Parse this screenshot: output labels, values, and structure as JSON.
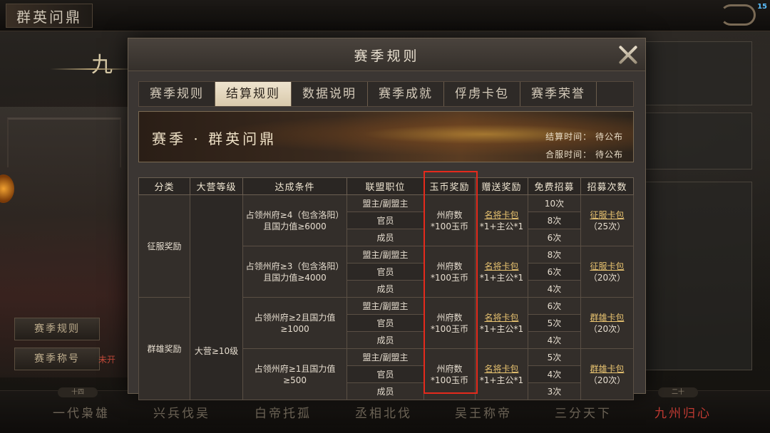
{
  "background": {
    "top_title": "群英问鼎",
    "version_badge": "15",
    "chapter_title_char": "九",
    "left_buttons": [
      "赛季规则",
      "赛季称号"
    ],
    "left_red_text": "未开",
    "chapters": [
      {
        "label": "一代枭雄",
        "num": "十四"
      },
      {
        "label": "兴兵伐吴",
        "num": ""
      },
      {
        "label": "白帝托孤",
        "num": ""
      },
      {
        "label": "丞相北伐",
        "num": ""
      },
      {
        "label": "吴王称帝",
        "num": ""
      },
      {
        "label": "三分天下",
        "num": ""
      },
      {
        "label": "九州归心",
        "num": "二十"
      }
    ]
  },
  "modal": {
    "title": "赛季规则",
    "tabs": [
      "赛季规则",
      "结算规则",
      "数据说明",
      "赛季成就",
      "俘虏卡包",
      "赛季荣誉"
    ],
    "active_tab": 1,
    "banner": {
      "title": "赛季 · 群英问鼎",
      "settle_time": "结算时间：  待公布",
      "merge_time": "合服时间：  待公布"
    },
    "table": {
      "headers": [
        "分类",
        "大营等级",
        "达成条件",
        "联盟职位",
        "玉币奖励",
        "赠送奖励",
        "免费招募",
        "招募次数"
      ],
      "category_conquer": "征服奖励",
      "category_heroes": "群雄奖励",
      "camp_level": "大营≥10级",
      "position_leader": "盟主/副盟主",
      "position_officer": "官员",
      "position_member": "成员",
      "jade_reward_line1": "州府数",
      "jade_reward_line2": "*100玉币",
      "gift_line1": "名将卡包",
      "gift_line2": "*1+主公*1",
      "groups": [
        {
          "condition": "占领州府≥4（包含洛阳）且国力值≥6000",
          "recruit": [
            "10次",
            "8次",
            "6次"
          ],
          "pack_name": "征服卡包",
          "pack_count": "（25次）"
        },
        {
          "condition": "占领州府≥3（包含洛阳）且国力值≥4000",
          "recruit": [
            "8次",
            "6次",
            "4次"
          ],
          "pack_name": "征服卡包",
          "pack_count": "（20次）"
        },
        {
          "condition": "占领州府≥2且国力值≥1000",
          "recruit": [
            "6次",
            "5次",
            "4次"
          ],
          "pack_name": "群雄卡包",
          "pack_count": "（20次）"
        },
        {
          "condition": "占领州府≥1且国力值≥500",
          "recruit": [
            "5次",
            "4次",
            "3次"
          ],
          "pack_name": "群雄卡包",
          "pack_count": "（20次）"
        }
      ]
    }
  },
  "colors": {
    "highlight": "#e52a1c",
    "gold_link": "#e8c370",
    "active_chapter": "#c03a32"
  }
}
